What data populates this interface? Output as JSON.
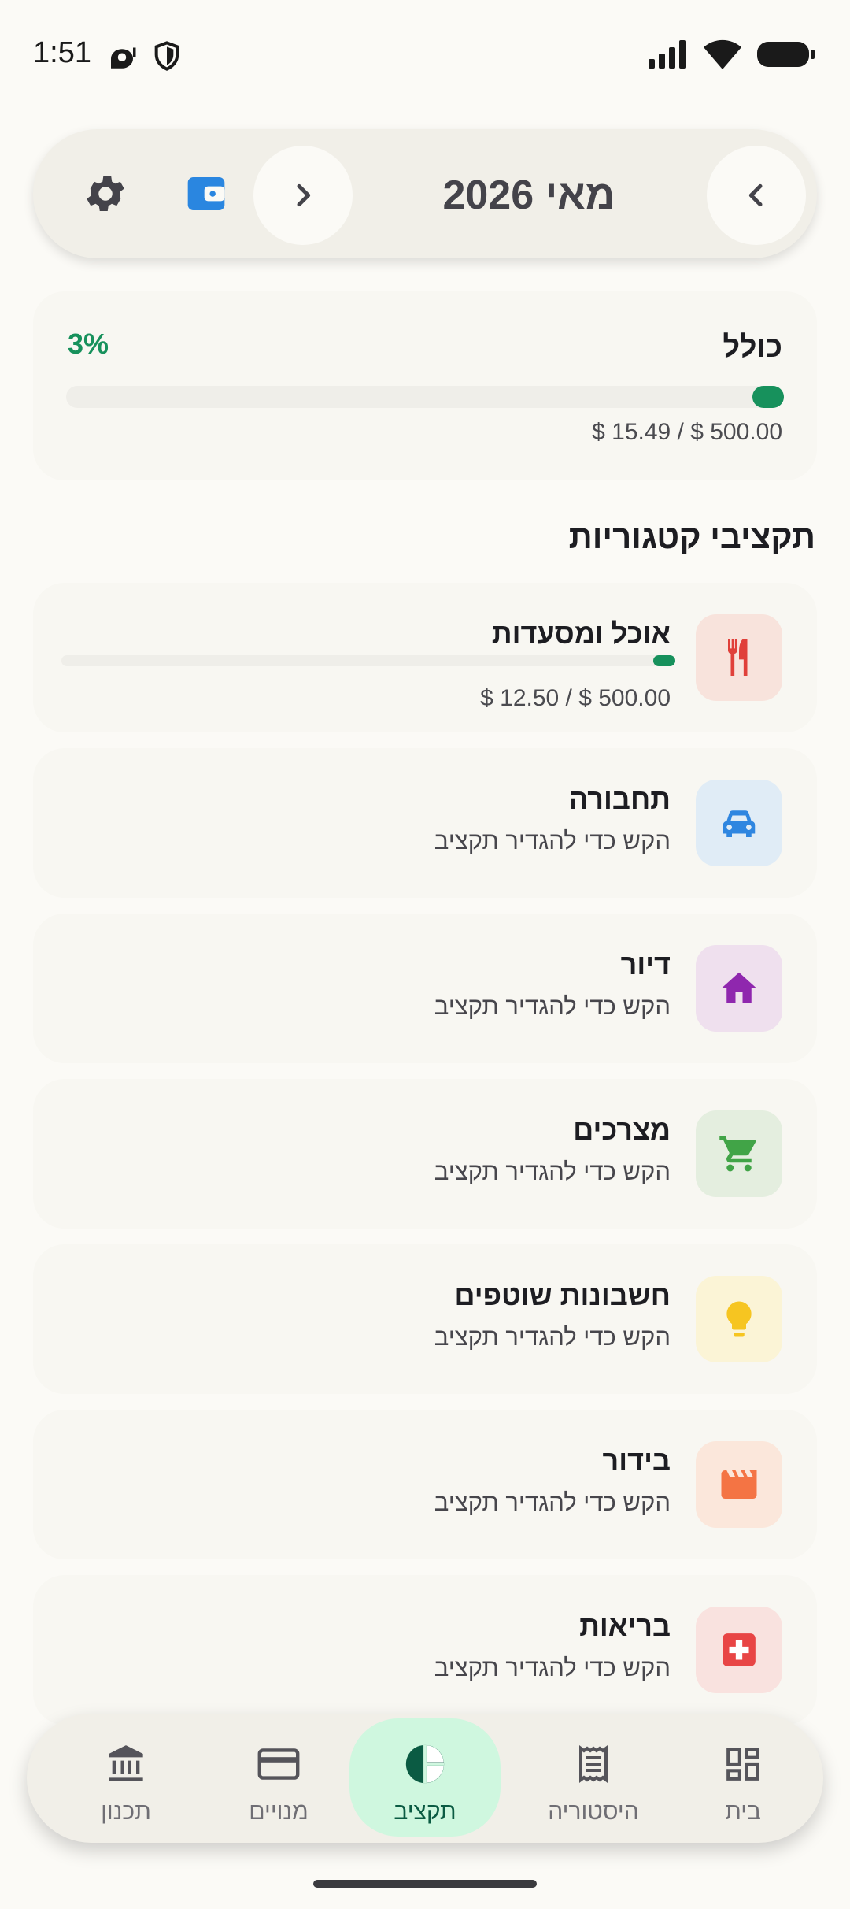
{
  "status_bar": {
    "time": "1:51"
  },
  "header": {
    "month_label": "מאי 2026"
  },
  "overall": {
    "title": "כולל",
    "percent_label": "3%",
    "progress": 0.031,
    "amount_text": "$ 15.49 / $ 500.00"
  },
  "section_title": "תקציבי קטגוריות",
  "categories": [
    {
      "name": "אוכל ומסעדות",
      "amount_text": "$ 12.50 / $ 500.00",
      "progress": 0.025,
      "icon": "restaurant-icon",
      "icon_color": "#e0403a",
      "bg_color": "#f8e3dc"
    },
    {
      "name": "תחבורה",
      "hint": "הקש כדי להגדיר תקציב",
      "icon": "car-icon",
      "icon_color": "#2f86e0",
      "bg_color": "#e0ecf6"
    },
    {
      "name": "דיור",
      "hint": "הקש כדי להגדיר תקציב",
      "icon": "home-icon",
      "icon_color": "#8f27ae",
      "bg_color": "#efe0ee"
    },
    {
      "name": "מצרכים",
      "hint": "הקש כדי להגדיר תקציב",
      "icon": "cart-icon",
      "icon_color": "#41a447",
      "bg_color": "#e4eedf"
    },
    {
      "name": "חשבונות שוטפים",
      "hint": "הקש כדי להגדיר תקציב",
      "icon": "lightbulb-icon",
      "icon_color": "#f6c521",
      "bg_color": "#fbf4d6"
    },
    {
      "name": "בידור",
      "hint": "הקש כדי להגדיר תקציב",
      "icon": "clapperboard-icon",
      "icon_color": "#f47444",
      "bg_color": "#fbe7db"
    },
    {
      "name": "בריאות",
      "hint": "הקש כדי להגדיר תקציב",
      "icon": "medical-icon",
      "icon_color": "#e84545",
      "bg_color": "#f9e2df"
    }
  ],
  "nav": {
    "items": [
      {
        "label": "בית",
        "icon": "dashboard-icon"
      },
      {
        "label": "היסטוריה",
        "icon": "receipt-icon"
      },
      {
        "label": "תקציב",
        "icon": "pie-chart-icon",
        "active": true
      },
      {
        "label": "מנויים",
        "icon": "card-icon"
      },
      {
        "label": "תכנון",
        "icon": "bank-icon"
      }
    ]
  },
  "colors": {
    "accent": "#17915c",
    "background": "#fbfaf6",
    "active_pill": "#cff7df"
  }
}
